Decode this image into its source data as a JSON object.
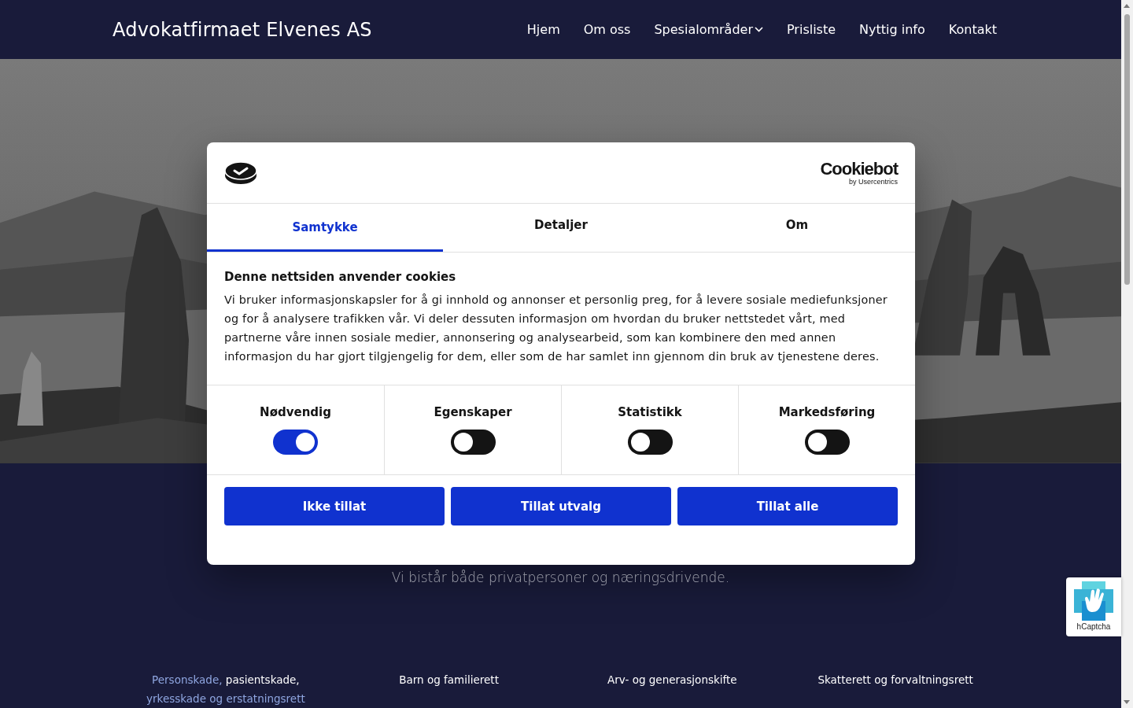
{
  "header": {
    "brand": "Advokatfirmaet Elvenes AS",
    "nav": [
      {
        "label": "Hjem",
        "dropdown": false
      },
      {
        "label": "Om oss",
        "dropdown": false
      },
      {
        "label": "Spesialområder",
        "dropdown": true
      },
      {
        "label": "Prisliste",
        "dropdown": false
      },
      {
        "label": "Nyttig info",
        "dropdown": false
      },
      {
        "label": "Kontakt",
        "dropdown": false
      }
    ]
  },
  "intro": "Vi bistår både privatpersoner og næringsdrivende.",
  "areas": [
    {
      "parts": [
        {
          "text": "Personskade,",
          "highlighted": false
        },
        {
          "text": "pasientskade,",
          "highlighted": true
        },
        {
          "text": "yrkesskade og erstatningsrett",
          "highlighted": false
        }
      ]
    },
    {
      "parts": [
        {
          "text": "Barn og familierett",
          "highlighted": true
        }
      ]
    },
    {
      "parts": [
        {
          "text": "Arv- og generasjonskifte",
          "highlighted": true
        }
      ]
    },
    {
      "parts": [
        {
          "text": "Skatterett og forvaltningsrett",
          "highlighted": true
        }
      ]
    }
  ],
  "cookie_dialog": {
    "brand": "Cookiebot",
    "brand_sub": "by Usercentrics",
    "tabs": [
      {
        "label": "Samtykke",
        "selected": true
      },
      {
        "label": "Detaljer",
        "selected": false
      },
      {
        "label": "Om",
        "selected": false
      }
    ],
    "heading": "Denne nettsiden anvender cookies",
    "body": "Vi bruker informasjonskapsler for å gi innhold og annonser et personlig preg, for å levere sosiale mediefunksjoner og for å analysere trafikken vår. Vi deler dessuten informasjon om hvordan du bruker nettstedet vårt, med partnerne våre innen sosiale medier, annonsering og analysearbeid, som kan kombinere den med annen informasjon du har gjort tilgjengelig for dem, eller som de har samlet inn gjennom din bruk av tjenestene deres.",
    "categories": [
      {
        "label": "Nødvendig",
        "on": true
      },
      {
        "label": "Egenskaper",
        "on": false
      },
      {
        "label": "Statistikk",
        "on": false
      },
      {
        "label": "Markedsføring",
        "on": false
      }
    ],
    "buttons": [
      "Ikke tillat",
      "Tillat utvalg",
      "Tillat alle"
    ]
  },
  "captcha": {
    "label": "hCaptcha"
  }
}
